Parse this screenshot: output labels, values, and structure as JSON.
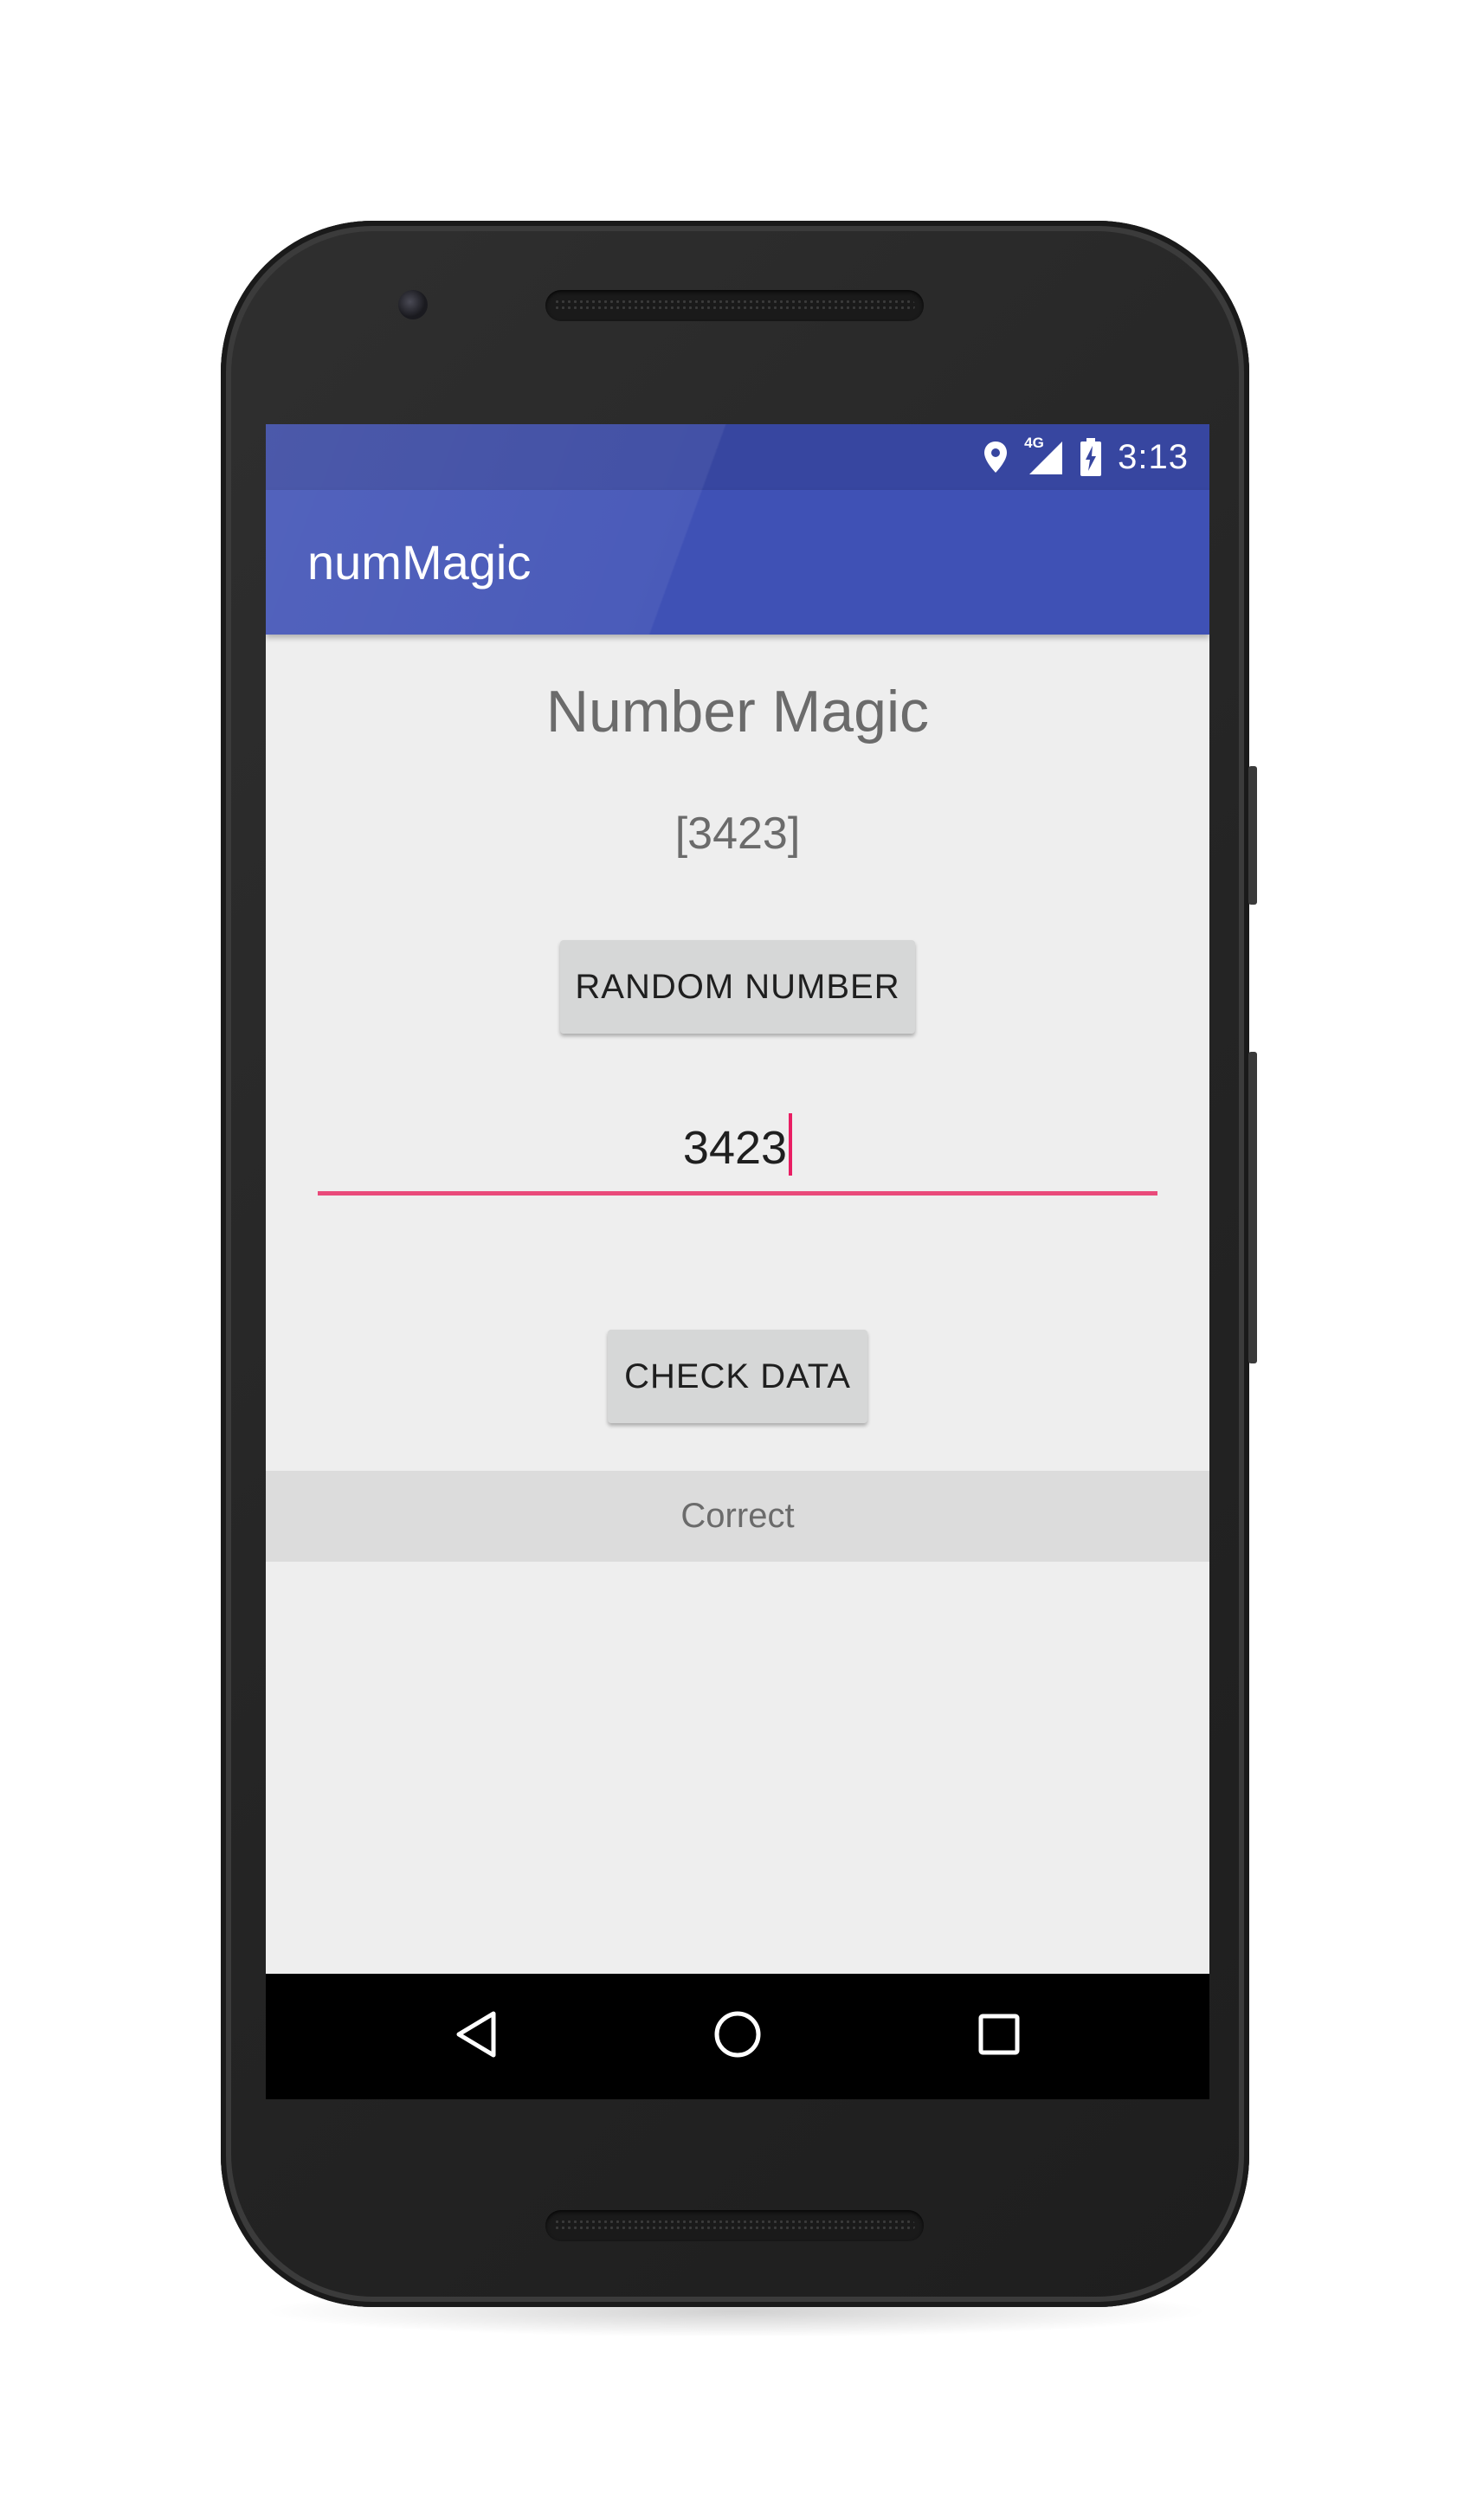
{
  "status_bar": {
    "network_label": "4G",
    "time": "3:13",
    "icons": [
      "location-icon",
      "signal-icon",
      "battery-charging-icon"
    ]
  },
  "toolbar": {
    "title": "numMagic"
  },
  "main": {
    "heading": "Number Magic",
    "number_display": "[3423]",
    "random_button_label": "RANDOM NUMBER",
    "input": {
      "value": "3423",
      "placeholder": ""
    },
    "check_button_label": "CHECK DATA",
    "result_text": "Correct"
  },
  "nav_bar": {
    "icons": [
      "back-icon",
      "home-icon",
      "recents-icon"
    ]
  },
  "colors": {
    "status_bar": "#3746a0",
    "toolbar": "#3f51b5",
    "accent": "#e91e63",
    "screen_background": "#eeeeee",
    "button_background": "#d6d7d7",
    "result_background": "#dcdcdc"
  }
}
